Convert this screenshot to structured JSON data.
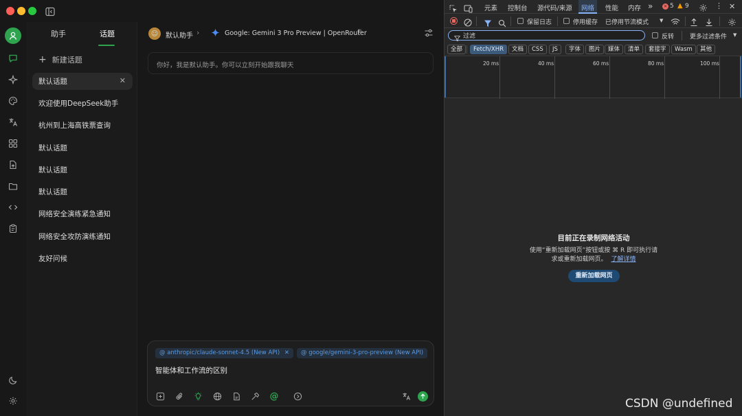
{
  "app": {
    "sidebar_tabs": [
      "助手",
      "话题"
    ],
    "new_topic": "新建话题",
    "topics": [
      "默认话题",
      "欢迎使用DeepSeek助手",
      "杭州到上海高铁票查询",
      "默认话题",
      "默认话题",
      "默认话题",
      "网络安全演练紧急通知",
      "网络安全攻防演练通知",
      "友好问候"
    ],
    "active_topic_index": 0,
    "header": {
      "assistant": "默认助手",
      "model": "Google: Gemini 3 Pro Preview | OpenRouter"
    },
    "greeting": "你好，我是默认助手。你可以立刻开始跟我聊天",
    "composer": {
      "mentions": [
        "@ anthropic/claude-sonnet-4.5 (New API)",
        "@ google/gemini-3-pro-preview (New API)"
      ],
      "text": "智能体和工作流的区别"
    },
    "colors": {
      "accent": "#2ea44f",
      "mention_text": "#5a9be6"
    }
  },
  "devtools": {
    "tabs": [
      "元素",
      "控制台",
      "源代码/来源",
      "网络",
      "性能",
      "内存"
    ],
    "active_tab": "网络",
    "error_count": "5",
    "warning_count": "9",
    "toolbar": {
      "preserve_log": "保留日志",
      "disable_cache": "停用缓存",
      "throttle": "已停用节流模式"
    },
    "filter": {
      "placeholder": "过滤",
      "invert": "反转",
      "more": "更多过滤条件"
    },
    "type_filters": [
      "全部",
      "Fetch/XHR",
      "文档",
      "CSS",
      "JS",
      "字体",
      "图片",
      "媒体",
      "清单",
      "套接字",
      "Wasm",
      "其他"
    ],
    "active_type_filter": "Fetch/XHR",
    "timeline_ticks": [
      "20 ms",
      "40 ms",
      "60 ms",
      "80 ms",
      "100 ms"
    ],
    "empty": {
      "title": "目前正在录制网络活动",
      "line1": "使用“重新加载网页”按钮或按 ⌘ R 即可执行请",
      "line2": "求或重新加载网页。",
      "link": "了解详情",
      "button": "重新加载网页"
    }
  },
  "watermark": "CSDN @undefined"
}
